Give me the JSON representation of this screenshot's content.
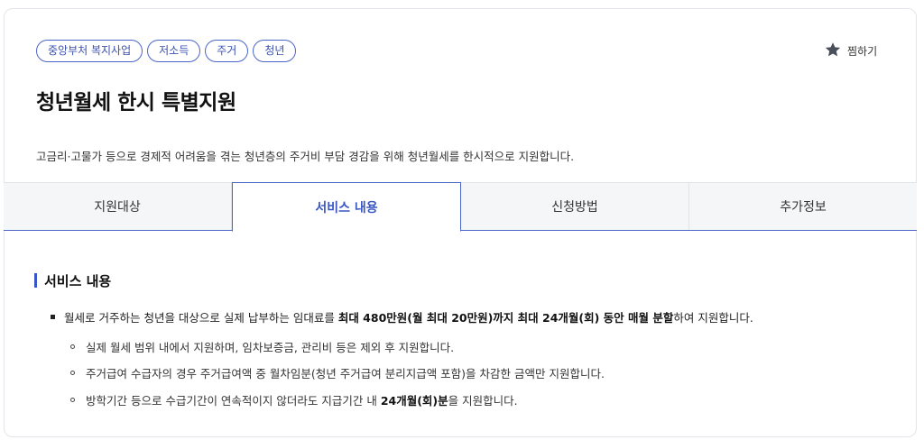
{
  "tags": [
    "중앙부처 복지사업",
    "저소득",
    "주거",
    "청년"
  ],
  "bookmark": {
    "label": "찜하기",
    "icon": "star-icon"
  },
  "title": "청년월세 한시 특별지원",
  "summary": "고금리·고물가 등으로 경제적 어려움을 겪는 청년층의 주거비 부담 경감을 위해 청년월세를 한시적으로 지원합니다.",
  "tabs": [
    {
      "label": "지원대상",
      "active": false
    },
    {
      "label": "서비스 내용",
      "active": true
    },
    {
      "label": "신청방법",
      "active": false
    },
    {
      "label": "추가정보",
      "active": false
    }
  ],
  "section": {
    "title": "서비스 내용",
    "bullet": {
      "pre": "월세로 거주하는 청년을 대상으로 실제 납부하는 임대료를 ",
      "bold": "최대 480만원(월 최대 20만원)까지 최대 24개월(회) 동안 매월 분할",
      "post": "하여 지원합니다."
    },
    "subs": [
      {
        "pre": "실제 월세 범위 내에서 지원하며, 임차보증금, 관리비 등은 제외 후 지원합니다.",
        "bold": "",
        "post": ""
      },
      {
        "pre": "주거급여 수급자의 경우 주거급여액 중 월차임분(청년 주거급여 분리지급액 포함)을 차감한 금액만 지원합니다.",
        "bold": "",
        "post": ""
      },
      {
        "pre": "방학기간 등으로 수급기간이 연속적이지 않더라도 지급기간 내 ",
        "bold": "24개월(회)분",
        "post": "을 지원합니다."
      }
    ]
  },
  "colors": {
    "accent": "#3a56c4",
    "tag_border": "#4c66c8",
    "tab_bg": "#f5f6f8"
  }
}
